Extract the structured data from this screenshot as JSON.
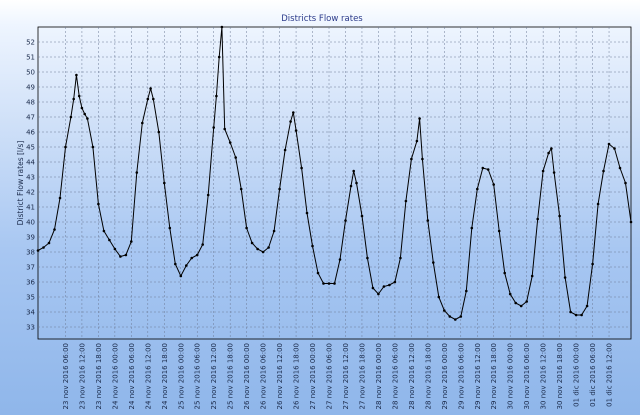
{
  "chart_data": {
    "type": "line",
    "title": "Districts Flow rates",
    "xlabel": "",
    "ylabel": "District Flow rates [l/s]",
    "ylim": [
      32.2,
      53
    ],
    "yticks": [
      33,
      34,
      35,
      36,
      37,
      38,
      39,
      40,
      41,
      42,
      43,
      44,
      45,
      46,
      47,
      48,
      49,
      50,
      51,
      52
    ],
    "x_range": [
      "2016-11-22T20:00",
      "2016-12-01T20:00"
    ],
    "x_tick_labels": [
      "23 nov 2016 06:00",
      "23 nov 2016 12:00",
      "23 nov 2016 18:00",
      "24 nov 2016 00:00",
      "24 nov 2016 06:00",
      "24 nov 2016 12:00",
      "24 nov 2016 18:00",
      "25 nov 2016 00:00",
      "25 nov 2016 06:00",
      "25 nov 2016 12:00",
      "25 nov 2016 18:00",
      "26 nov 2016 00:00",
      "26 nov 2016 06:00",
      "26 nov 2016 12:00",
      "26 nov 2016 18:00",
      "27 nov 2016 00:00",
      "27 nov 2016 06:00",
      "27 nov 2016 12:00",
      "27 nov 2016 18:00",
      "28 nov 2016 00:00",
      "28 nov 2016 06:00",
      "28 nov 2016 12:00",
      "28 nov 2016 18:00",
      "29 nov 2016 00:00",
      "29 nov 2016 06:00",
      "29 nov 2016 12:00",
      "29 nov 2016 18:00",
      "30 nov 2016 00:00",
      "30 nov 2016 06:00",
      "30 nov 2016 12:00",
      "30 nov 2016 18:00",
      "01 dic 2016 00:00",
      "01 dic 2016 06:00",
      "01 dic 2016 12:00"
    ],
    "x_tick_times": [
      "2016-11-23T06:00",
      "2016-11-23T12:00",
      "2016-11-23T18:00",
      "2016-11-24T00:00",
      "2016-11-24T06:00",
      "2016-11-24T12:00",
      "2016-11-24T18:00",
      "2016-11-25T00:00",
      "2016-11-25T06:00",
      "2016-11-25T12:00",
      "2016-11-25T18:00",
      "2016-11-26T00:00",
      "2016-11-26T06:00",
      "2016-11-26T12:00",
      "2016-11-26T18:00",
      "2016-11-27T00:00",
      "2016-11-27T06:00",
      "2016-11-27T12:00",
      "2016-11-27T18:00",
      "2016-11-28T00:00",
      "2016-11-28T06:00",
      "2016-11-28T12:00",
      "2016-11-28T18:00",
      "2016-11-29T00:00",
      "2016-11-29T06:00",
      "2016-11-29T12:00",
      "2016-11-29T18:00",
      "2016-11-30T00:00",
      "2016-11-30T06:00",
      "2016-11-30T12:00",
      "2016-11-30T18:00",
      "2016-12-01T00:00",
      "2016-12-01T06:00",
      "2016-12-01T12:00"
    ],
    "grid": true,
    "legend": "none",
    "line_color": "#000000",
    "series": [
      {
        "values": [
          {
            "x": "2016-11-22T20:00",
            "y": 38.1
          },
          {
            "x": "2016-11-22T22:00",
            "y": 38.3
          },
          {
            "x": "2016-11-23T00:00",
            "y": 38.6
          },
          {
            "x": "2016-11-23T02:00",
            "y": 39.5
          },
          {
            "x": "2016-11-23T04:00",
            "y": 41.6
          },
          {
            "x": "2016-11-23T06:00",
            "y": 45.0
          },
          {
            "x": "2016-11-23T08:00",
            "y": 47.0
          },
          {
            "x": "2016-11-23T09:00",
            "y": 48.2
          },
          {
            "x": "2016-11-23T10:00",
            "y": 49.8
          },
          {
            "x": "2016-11-23T11:00",
            "y": 48.4
          },
          {
            "x": "2016-11-23T12:00",
            "y": 47.6
          },
          {
            "x": "2016-11-23T13:00",
            "y": 47.2
          },
          {
            "x": "2016-11-23T14:00",
            "y": 46.9
          },
          {
            "x": "2016-11-23T16:00",
            "y": 45.0
          },
          {
            "x": "2016-11-23T18:00",
            "y": 41.2
          },
          {
            "x": "2016-11-23T20:00",
            "y": 39.4
          },
          {
            "x": "2016-11-23T22:00",
            "y": 38.8
          },
          {
            "x": "2016-11-24T00:00",
            "y": 38.2
          },
          {
            "x": "2016-11-24T02:00",
            "y": 37.7
          },
          {
            "x": "2016-11-24T04:00",
            "y": 37.8
          },
          {
            "x": "2016-11-24T06:00",
            "y": 38.7
          },
          {
            "x": "2016-11-24T08:00",
            "y": 43.3
          },
          {
            "x": "2016-11-24T10:00",
            "y": 46.6
          },
          {
            "x": "2016-11-24T12:00",
            "y": 48.2
          },
          {
            "x": "2016-11-24T13:00",
            "y": 48.9
          },
          {
            "x": "2016-11-24T14:00",
            "y": 48.2
          },
          {
            "x": "2016-11-24T16:00",
            "y": 46.0
          },
          {
            "x": "2016-11-24T18:00",
            "y": 42.6
          },
          {
            "x": "2016-11-24T20:00",
            "y": 39.6
          },
          {
            "x": "2016-11-24T22:00",
            "y": 37.2
          },
          {
            "x": "2016-11-25T00:00",
            "y": 36.4
          },
          {
            "x": "2016-11-25T02:00",
            "y": 37.1
          },
          {
            "x": "2016-11-25T04:00",
            "y": 37.6
          },
          {
            "x": "2016-11-25T06:00",
            "y": 37.8
          },
          {
            "x": "2016-11-25T08:00",
            "y": 38.5
          },
          {
            "x": "2016-11-25T10:00",
            "y": 41.8
          },
          {
            "x": "2016-11-25T12:00",
            "y": 46.3
          },
          {
            "x": "2016-11-25T13:00",
            "y": 48.4
          },
          {
            "x": "2016-11-25T14:00",
            "y": 51.0
          },
          {
            "x": "2016-11-25T15:00",
            "y": 53.0
          },
          {
            "x": "2016-11-25T16:00",
            "y": 46.2
          },
          {
            "x": "2016-11-25T18:00",
            "y": 45.3
          },
          {
            "x": "2016-11-25T20:00",
            "y": 44.3
          },
          {
            "x": "2016-11-25T22:00",
            "y": 42.2
          },
          {
            "x": "2016-11-26T00:00",
            "y": 39.6
          },
          {
            "x": "2016-11-26T02:00",
            "y": 38.6
          },
          {
            "x": "2016-11-26T04:00",
            "y": 38.2
          },
          {
            "x": "2016-11-26T06:00",
            "y": 38.0
          },
          {
            "x": "2016-11-26T08:00",
            "y": 38.3
          },
          {
            "x": "2016-11-26T10:00",
            "y": 39.4
          },
          {
            "x": "2016-11-26T12:00",
            "y": 42.2
          },
          {
            "x": "2016-11-26T14:00",
            "y": 44.8
          },
          {
            "x": "2016-11-26T16:00",
            "y": 46.7
          },
          {
            "x": "2016-11-26T17:00",
            "y": 47.3
          },
          {
            "x": "2016-11-26T18:00",
            "y": 46.1
          },
          {
            "x": "2016-11-26T20:00",
            "y": 43.6
          },
          {
            "x": "2016-11-26T22:00",
            "y": 40.6
          },
          {
            "x": "2016-11-27T00:00",
            "y": 38.4
          },
          {
            "x": "2016-11-27T02:00",
            "y": 36.6
          },
          {
            "x": "2016-11-27T04:00",
            "y": 35.9
          },
          {
            "x": "2016-11-27T06:00",
            "y": 35.9
          },
          {
            "x": "2016-11-27T08:00",
            "y": 35.9
          },
          {
            "x": "2016-11-27T10:00",
            "y": 37.5
          },
          {
            "x": "2016-11-27T12:00",
            "y": 40.1
          },
          {
            "x": "2016-11-27T14:00",
            "y": 42.4
          },
          {
            "x": "2016-11-27T15:00",
            "y": 43.4
          },
          {
            "x": "2016-11-27T16:00",
            "y": 42.6
          },
          {
            "x": "2016-11-27T18:00",
            "y": 40.4
          },
          {
            "x": "2016-11-27T20:00",
            "y": 37.6
          },
          {
            "x": "2016-11-27T22:00",
            "y": 35.6
          },
          {
            "x": "2016-11-28T00:00",
            "y": 35.2
          },
          {
            "x": "2016-11-28T02:00",
            "y": 35.7
          },
          {
            "x": "2016-11-28T04:00",
            "y": 35.8
          },
          {
            "x": "2016-11-28T06:00",
            "y": 36.0
          },
          {
            "x": "2016-11-28T08:00",
            "y": 37.6
          },
          {
            "x": "2016-11-28T10:00",
            "y": 41.4
          },
          {
            "x": "2016-11-28T12:00",
            "y": 44.2
          },
          {
            "x": "2016-11-28T14:00",
            "y": 45.4
          },
          {
            "x": "2016-11-28T15:00",
            "y": 46.9
          },
          {
            "x": "2016-11-28T16:00",
            "y": 44.2
          },
          {
            "x": "2016-11-28T18:00",
            "y": 40.1
          },
          {
            "x": "2016-11-28T20:00",
            "y": 37.3
          },
          {
            "x": "2016-11-28T22:00",
            "y": 35.0
          },
          {
            "x": "2016-11-29T00:00",
            "y": 34.1
          },
          {
            "x": "2016-11-29T02:00",
            "y": 33.7
          },
          {
            "x": "2016-11-29T04:00",
            "y": 33.5
          },
          {
            "x": "2016-11-29T06:00",
            "y": 33.7
          },
          {
            "x": "2016-11-29T08:00",
            "y": 35.4
          },
          {
            "x": "2016-11-29T10:00",
            "y": 39.6
          },
          {
            "x": "2016-11-29T12:00",
            "y": 42.2
          },
          {
            "x": "2016-11-29T14:00",
            "y": 43.6
          },
          {
            "x": "2016-11-29T16:00",
            "y": 43.5
          },
          {
            "x": "2016-11-29T18:00",
            "y": 42.5
          },
          {
            "x": "2016-11-29T20:00",
            "y": 39.4
          },
          {
            "x": "2016-11-29T22:00",
            "y": 36.6
          },
          {
            "x": "2016-11-30T00:00",
            "y": 35.2
          },
          {
            "x": "2016-11-30T02:00",
            "y": 34.6
          },
          {
            "x": "2016-11-30T04:00",
            "y": 34.4
          },
          {
            "x": "2016-11-30T06:00",
            "y": 34.7
          },
          {
            "x": "2016-11-30T08:00",
            "y": 36.4
          },
          {
            "x": "2016-11-30T10:00",
            "y": 40.2
          },
          {
            "x": "2016-11-30T12:00",
            "y": 43.4
          },
          {
            "x": "2016-11-30T14:00",
            "y": 44.6
          },
          {
            "x": "2016-11-30T15:00",
            "y": 44.9
          },
          {
            "x": "2016-11-30T16:00",
            "y": 43.3
          },
          {
            "x": "2016-11-30T18:00",
            "y": 40.4
          },
          {
            "x": "2016-11-30T20:00",
            "y": 36.3
          },
          {
            "x": "2016-11-30T22:00",
            "y": 34.0
          },
          {
            "x": "2016-12-01T00:00",
            "y": 33.8
          },
          {
            "x": "2016-12-01T02:00",
            "y": 33.8
          },
          {
            "x": "2016-12-01T04:00",
            "y": 34.4
          },
          {
            "x": "2016-12-01T06:00",
            "y": 37.2
          },
          {
            "x": "2016-12-01T08:00",
            "y": 41.2
          },
          {
            "x": "2016-12-01T10:00",
            "y": 43.4
          },
          {
            "x": "2016-12-01T12:00",
            "y": 45.2
          },
          {
            "x": "2016-12-01T14:00",
            "y": 44.9
          },
          {
            "x": "2016-12-01T16:00",
            "y": 43.6
          },
          {
            "x": "2016-12-01T18:00",
            "y": 42.6
          },
          {
            "x": "2016-12-01T20:00",
            "y": 40.0
          }
        ]
      }
    ]
  }
}
